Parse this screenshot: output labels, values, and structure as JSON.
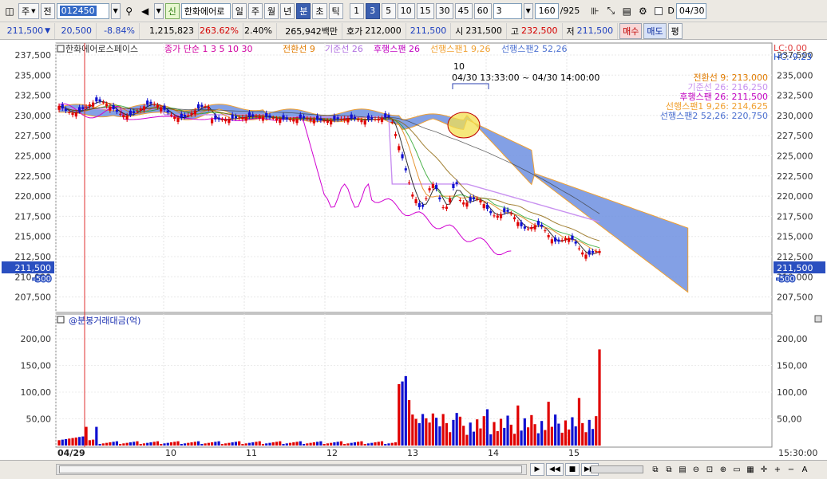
{
  "toolbar": {
    "market": "주",
    "jeon": "전",
    "code": "012450",
    "sin": "신",
    "name": "한화에어로",
    "periods": [
      "일",
      "주",
      "월",
      "년",
      "분",
      "초",
      "틱"
    ],
    "minutes": [
      "1",
      "3",
      "5",
      "10",
      "15",
      "30",
      "45",
      "60"
    ],
    "minute_value": "3",
    "count": "160",
    "count_total": "/925",
    "d_label": "D",
    "date": "04/30"
  },
  "quote": {
    "price": "211,500",
    "change": "20,500",
    "rate": "-8.84%",
    "volume": "1,215,823",
    "ratio": "263.62%",
    "turnover": "2.40%",
    "amount": "265,942백만",
    "bid_label": "호가",
    "bid": "212,000",
    "ask": "211,500",
    "open_label": "시",
    "open": "231,500",
    "high_label": "고",
    "high": "232,500",
    "low_label": "저",
    "low": "211,500",
    "buy": "매수",
    "sell": "매도",
    "eval": "평"
  },
  "legend": {
    "stock": "한화에어로스페이스",
    "ma": "종가 단순 1  3  5  10  30",
    "tenkan": "전환선 9",
    "kijun": "기준선 26",
    "chikou": "후행스팬 26",
    "senkou1": "선행스팬1 9,26",
    "senkou2": "선행스팬2 52,26"
  },
  "right_values": {
    "tenkan": "전환선 9: 213,000",
    "kijun": "기준선 26: 216,250",
    "chikou": "후행스팬 26: 211,500",
    "senkou1": "선행스팬1 9,26: 214,625",
    "senkou2": "선행스팬2 52,26: 220,750",
    "lc": "LC:0.00",
    "hc": "HC:-9.23"
  },
  "annotation": {
    "count": "10",
    "range": "04/30 13:33:00 ~ 04/30 14:00:00"
  },
  "price_axis": [
    "237,500",
    "235,000",
    "232,500",
    "230,000",
    "227,500",
    "225,000",
    "222,500",
    "220,000",
    "217,500",
    "215,000",
    "212,500",
    "210,000",
    "207,500"
  ],
  "price_tag": {
    "value": "211,500",
    "sub": "-500"
  },
  "vol_title": "@분봉거래대금(억)",
  "vol_axis": [
    "200,00",
    "150,00",
    "100,00",
    "50,00"
  ],
  "x_axis": [
    "04/29",
    "10",
    "11",
    "12",
    "13",
    "14",
    "15"
  ],
  "time_label": "15:30:00",
  "colors": {
    "up": "#e00000",
    "down": "#1010d0",
    "cloud": "#6d8fe0",
    "ma5": "#e07b00",
    "kijun": "#c890f0",
    "chikou": "#d000d0"
  },
  "icons": [
    "chart-icon",
    "dropdown-icon",
    "search-icon",
    "speaker-icon",
    "save-icon",
    "gear-icon"
  ],
  "chart_data": {
    "type": "candlestick",
    "price_range": [
      205000,
      240000
    ],
    "last_price": 211500,
    "volume_axis_range": [
      0,
      230
    ]
  }
}
